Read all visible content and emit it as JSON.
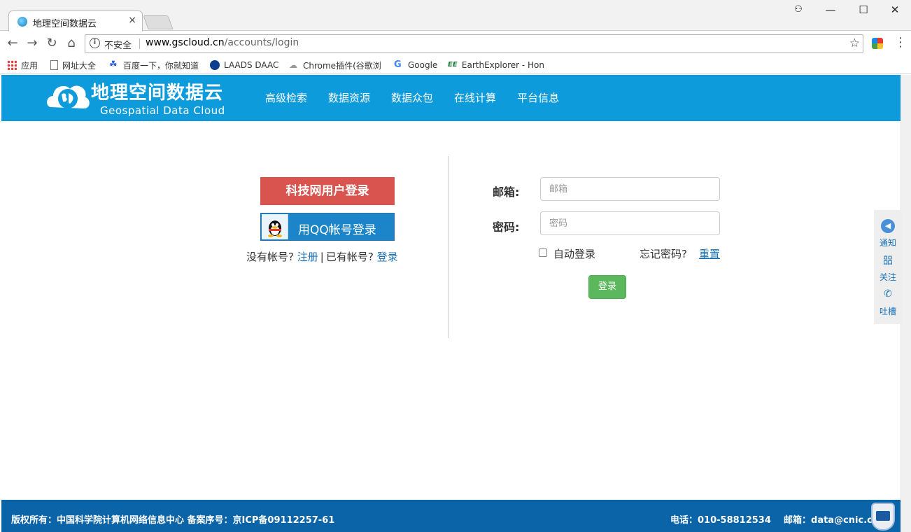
{
  "browser": {
    "tab_title": "地理空间数据云",
    "tab_close": "×",
    "insecure_label": "不安全",
    "url_host": "www.gscloud.cn",
    "url_path": "/accounts/login",
    "bookmarks": [
      {
        "label": "应用",
        "icon": "apps-grid-icon"
      },
      {
        "label": "网址大全",
        "icon": "page-icon"
      },
      {
        "label": "百度一下，你就知道",
        "icon": "baidu-paw-icon"
      },
      {
        "label": "LAADS DAAC",
        "icon": "nasa-icon"
      },
      {
        "label": "Chrome插件(谷歌浏",
        "icon": "chrome-ext-icon"
      },
      {
        "label": "Google",
        "icon": "google-g-icon"
      },
      {
        "label": "EarthExplorer - Hon",
        "icon": "ee-icon"
      }
    ]
  },
  "header": {
    "logo_cn": "地理空间数据云",
    "logo_en": "Geospatial Data Cloud",
    "nav": [
      "高级检索",
      "数据资源",
      "数据众包",
      "在线计算",
      "平台信息"
    ]
  },
  "login": {
    "kejiwang_button": "科技网用户登录",
    "qq_button": "用QQ帐号登录",
    "no_account": "没有帐号?",
    "register_link": "注册",
    "separator": "|",
    "have_account": "已有帐号?",
    "login_link": "登录",
    "email_label": "邮箱:",
    "email_placeholder": "邮箱",
    "password_label": "密码:",
    "password_placeholder": "密码",
    "auto_login": "自动登录",
    "forgot_password": "忘记密码?",
    "reset_link": "重置",
    "submit": "登录"
  },
  "side_panel": {
    "notice": "通知",
    "qr_glyph": "㗊",
    "follow": "关注",
    "phone_glyph": "✆",
    "feedback": "吐槽"
  },
  "footer": {
    "left": "版权所有：中国科学院计算机网络信息中心 备案序号：京ICP备09112257-61",
    "phone": "电话：010-58812534",
    "email": "邮箱：data@cnic.cn"
  }
}
